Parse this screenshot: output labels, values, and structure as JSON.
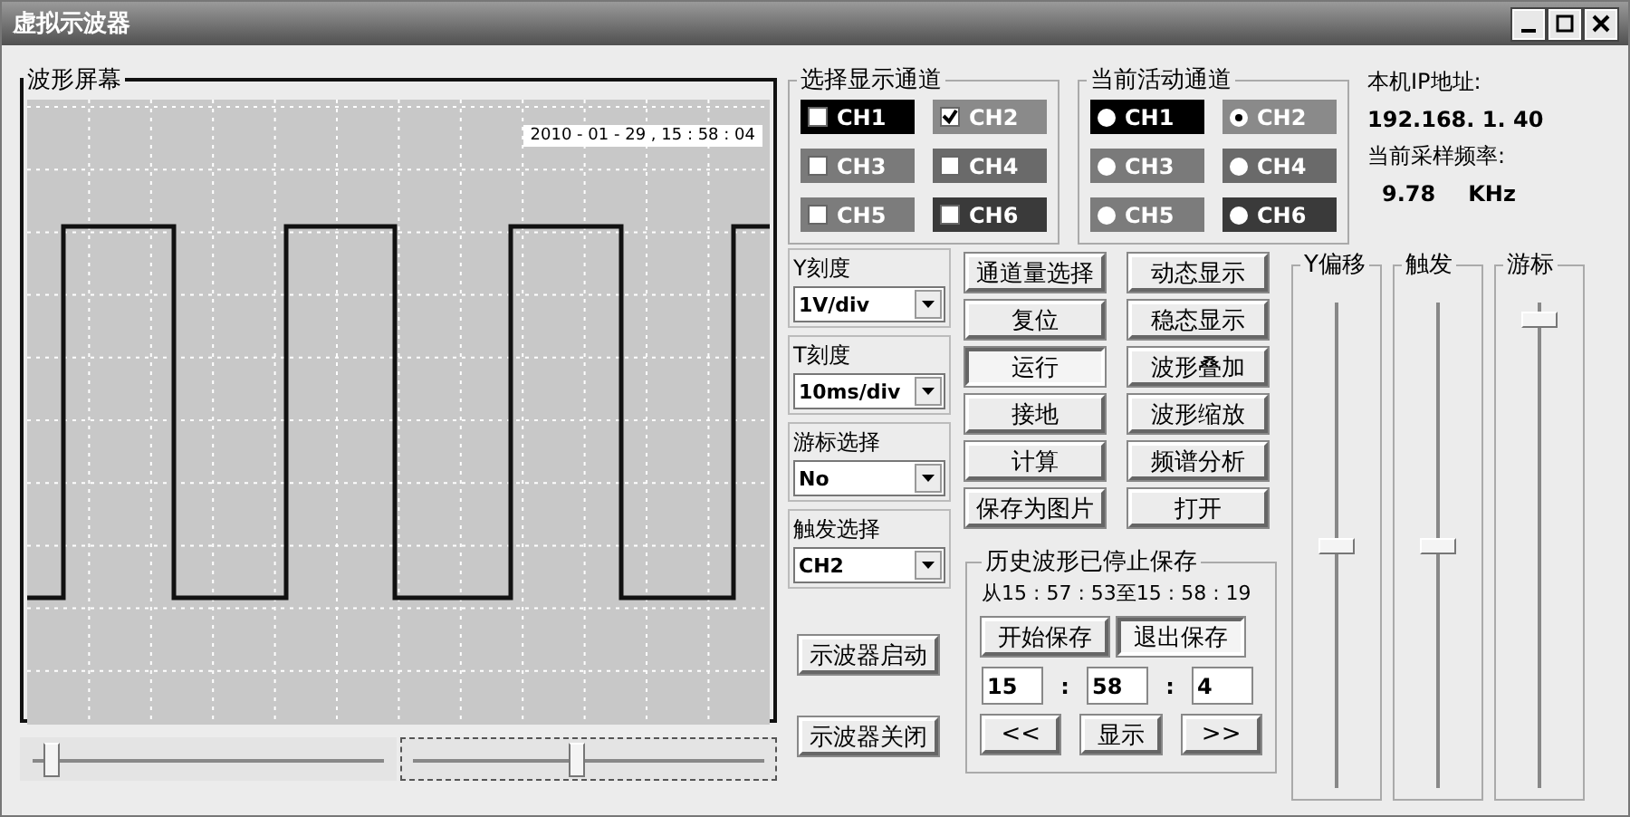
{
  "window": {
    "title": "虚拟示波器"
  },
  "scope": {
    "title": "波形屏幕",
    "timestamp": "2010 - 01 - 29 , 15 : 58 : 04"
  },
  "h_sliders": [
    {
      "level": 0.05,
      "focused": false
    },
    {
      "level": 0.45,
      "focused": true
    }
  ],
  "display_channels": {
    "title": "选择显示通道",
    "items": [
      {
        "label": "CH1",
        "checked": false,
        "color": "#000000"
      },
      {
        "label": "CH2",
        "checked": true,
        "color": "#8a8a8a"
      },
      {
        "label": "CH3",
        "checked": false,
        "color": "#7a7a7a"
      },
      {
        "label": "CH4",
        "checked": false,
        "color": "#6a6a6a"
      },
      {
        "label": "CH5",
        "checked": false,
        "color": "#7c7c7c"
      },
      {
        "label": "CH6",
        "checked": false,
        "color": "#3a3a3a"
      }
    ]
  },
  "active_channels": {
    "title": "当前活动通道",
    "items": [
      {
        "label": "CH1",
        "selected": false,
        "color": "#000000"
      },
      {
        "label": "CH2",
        "selected": true,
        "color": "#8a8a8a"
      },
      {
        "label": "CH3",
        "selected": false,
        "color": "#7a7a7a"
      },
      {
        "label": "CH4",
        "selected": false,
        "color": "#6a6a6a"
      },
      {
        "label": "CH5",
        "selected": false,
        "color": "#7c7c7c"
      },
      {
        "label": "CH6",
        "selected": false,
        "color": "#3a3a3a"
      }
    ]
  },
  "info": {
    "ip_label": "本机IP地址:",
    "ip": "192.168. 1. 40",
    "rate_label": "当前采样频率:",
    "rate": "9.78",
    "rate_unit": "KHz"
  },
  "selectors": [
    {
      "label": "Y刻度",
      "value": "1V/div"
    },
    {
      "label": "T刻度",
      "value": "10ms/div"
    },
    {
      "label": "游标选择",
      "value": "No"
    },
    {
      "label": "触发选择",
      "value": "CH2"
    }
  ],
  "buttons": [
    {
      "label": "通道量选择",
      "pressed": false
    },
    {
      "label": "动态显示",
      "pressed": false
    },
    {
      "label": "复位",
      "pressed": false
    },
    {
      "label": "稳态显示",
      "pressed": false
    },
    {
      "label": "运行",
      "pressed": true
    },
    {
      "label": "波形叠加",
      "pressed": false
    },
    {
      "label": "接地",
      "pressed": false
    },
    {
      "label": "波形缩放",
      "pressed": false
    },
    {
      "label": "计算",
      "pressed": false
    },
    {
      "label": "频谱分析",
      "pressed": false
    },
    {
      "label": "保存为图片",
      "pressed": false
    },
    {
      "label": "打开",
      "pressed": false
    }
  ],
  "power_buttons": [
    "示波器启动",
    "示波器关闭"
  ],
  "history": {
    "title": "历史波形已停止保存",
    "range": "从15 : 57 : 53至15 : 58 : 19",
    "buttons": [
      {
        "label": "开始保存",
        "pressed": false
      },
      {
        "label": "退出保存",
        "pressed": true
      }
    ],
    "fields": [
      "15",
      "58",
      "4"
    ],
    "separators": [
      ":",
      ":"
    ],
    "nav": [
      "<<",
      "显示",
      ">>"
    ]
  },
  "v_sliders": [
    {
      "label": "Y偏移",
      "level": 0.5
    },
    {
      "label": "触发",
      "level": 0.5
    },
    {
      "label": "游标",
      "level": 0.98
    }
  ]
}
